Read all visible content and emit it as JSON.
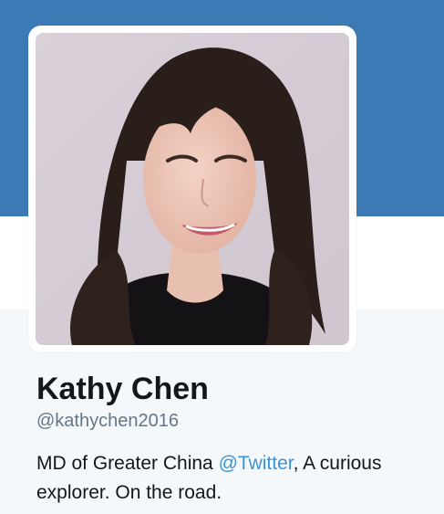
{
  "profile": {
    "display_name": "Kathy Chen",
    "handle": "@kathychen2016",
    "bio": {
      "prefix": "MD of Greater China ",
      "mention": "@Twitter",
      "suffix": ", A curious explorer. On the road."
    },
    "avatar_alt": "Kathy Chen"
  },
  "colors": {
    "header_banner": "#3b7ab5",
    "page_background": "#f5f8fa",
    "name_text": "#14171a",
    "handle_text": "#657786",
    "link": "#3b94d9"
  }
}
